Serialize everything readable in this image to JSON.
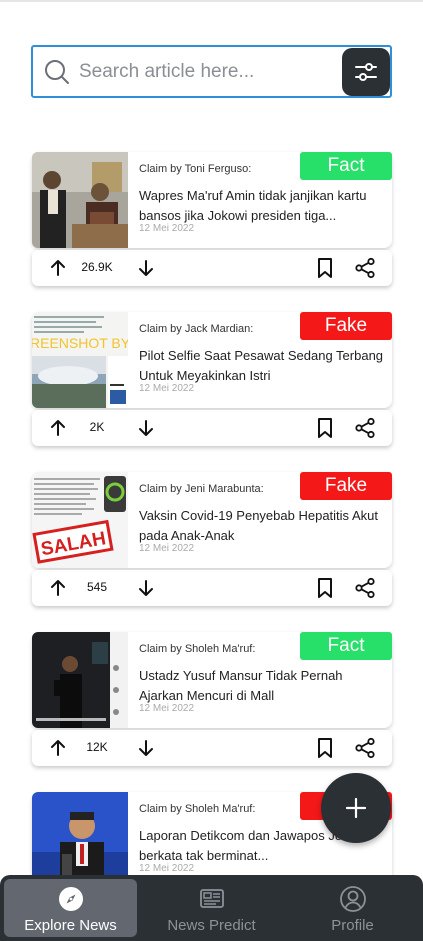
{
  "search": {
    "placeholder": "Search article here...",
    "filter_icon": "sliders-icon"
  },
  "articles": [
    {
      "claim_by": "Claim by Toni Ferguso:",
      "verdict": "Fact",
      "verdict_type": "fact",
      "title": "Wapres Ma'ruf Amin tidak janjikan kartu bansos jika Jokowi presiden tiga...",
      "date": "12 Mei 2022",
      "votes": "26.9K"
    },
    {
      "claim_by": "Claim by Jack Mardian:",
      "verdict": "Fake",
      "verdict_type": "fake",
      "title": "Pilot Selfie Saat Pesawat Sedang Terbang Untuk Meyakinkan Istri",
      "date": "12 Mei 2022",
      "votes": "2K",
      "thumb_text": "REENSHOT BY"
    },
    {
      "claim_by": "Claim by Jeni Marabunta:",
      "verdict": "Fake",
      "verdict_type": "fake",
      "title": "Vaksin Covid-19 Penyebab Hepatitis Akut pada Anak-Anak",
      "date": "12 Mei 2022",
      "votes": "545",
      "thumb_text": "SALAH"
    },
    {
      "claim_by": "Claim by Sholeh Ma'ruf:",
      "verdict": "Fact",
      "verdict_type": "fact",
      "title": "Ustadz Yusuf Mansur Tidak Pernah Ajarkan Mencuri di Mall",
      "date": "12 Mei 2022",
      "votes": "12K"
    },
    {
      "claim_by": "Claim by Sholeh Ma'ruf:",
      "verdict": "",
      "verdict_type": "fake",
      "title": "Laporan Detikcom dan Jawapos Jokowi berkata tak berminat...",
      "date": "12 Mei 2022",
      "votes": ""
    }
  ],
  "fab": {
    "icon": "plus-icon"
  },
  "nav": {
    "items": [
      {
        "label": "Explore News",
        "icon": "compass-icon",
        "active": true
      },
      {
        "label": "News Predict",
        "icon": "news-icon",
        "active": false
      },
      {
        "label": "Profile",
        "icon": "user-icon",
        "active": false
      }
    ]
  },
  "colors": {
    "fact": "#27e06a",
    "fake": "#f51818",
    "dark": "#2b3035",
    "search_border": "#2f8fd8"
  }
}
